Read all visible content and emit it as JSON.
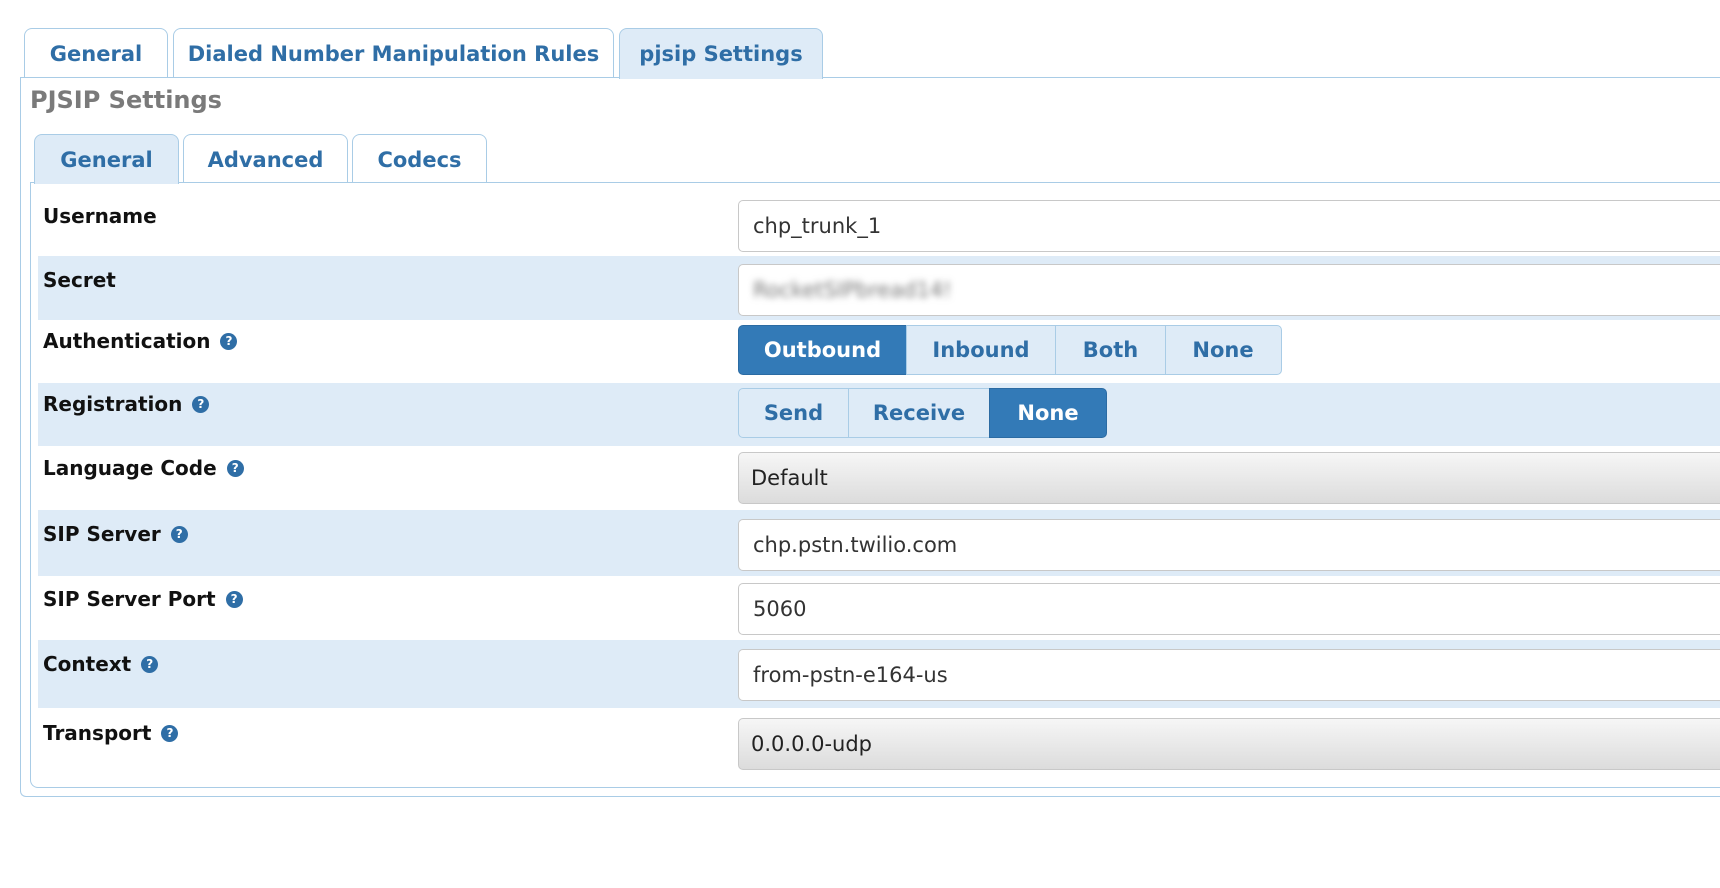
{
  "top_tabs": [
    {
      "label": "General",
      "active": false
    },
    {
      "label": "Dialed Number Manipulation Rules",
      "active": false
    },
    {
      "label": "pjsip Settings",
      "active": true
    }
  ],
  "section_title": "PJSIP Settings",
  "sub_tabs": [
    {
      "label": "General",
      "active": true
    },
    {
      "label": "Advanced",
      "active": false
    },
    {
      "label": "Codecs",
      "active": false
    }
  ],
  "fields": {
    "username": {
      "label": "Username",
      "value": "chp_trunk_1"
    },
    "secret": {
      "label": "Secret",
      "value": "RocketSIPbread14!"
    },
    "authentication": {
      "label": "Authentication",
      "options": [
        "Outbound",
        "Inbound",
        "Both",
        "None"
      ],
      "selected": "Outbound"
    },
    "registration": {
      "label": "Registration",
      "options": [
        "Send",
        "Receive",
        "None"
      ],
      "selected": "None"
    },
    "language_code": {
      "label": "Language Code",
      "value": "Default"
    },
    "sip_server": {
      "label": "SIP Server",
      "value": "chp.pstn.twilio.com"
    },
    "sip_server_port": {
      "label": "SIP Server Port",
      "value": "5060"
    },
    "context": {
      "label": "Context",
      "value": "from-pstn-e164-us"
    },
    "transport": {
      "label": "Transport",
      "value": "0.0.0.0-udp"
    }
  },
  "help_glyph": "?",
  "colors": {
    "accent": "#337ab7",
    "tab_border": "#a9cce6",
    "row_shade": "#deebf7",
    "link_blue": "#2f6ea6"
  }
}
